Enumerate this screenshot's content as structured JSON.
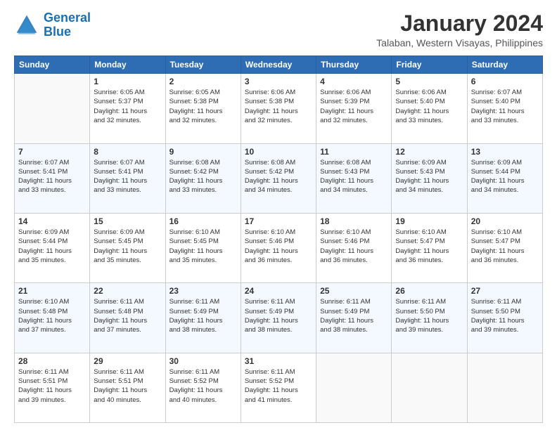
{
  "logo": {
    "line1": "General",
    "line2": "Blue"
  },
  "title": "January 2024",
  "subtitle": "Talaban, Western Visayas, Philippines",
  "days_of_week": [
    "Sunday",
    "Monday",
    "Tuesday",
    "Wednesday",
    "Thursday",
    "Friday",
    "Saturday"
  ],
  "weeks": [
    [
      {
        "day": "",
        "sunrise": "",
        "sunset": "",
        "daylight": ""
      },
      {
        "day": "1",
        "sunrise": "Sunrise: 6:05 AM",
        "sunset": "Sunset: 5:37 PM",
        "daylight": "Daylight: 11 hours and 32 minutes."
      },
      {
        "day": "2",
        "sunrise": "Sunrise: 6:05 AM",
        "sunset": "Sunset: 5:38 PM",
        "daylight": "Daylight: 11 hours and 32 minutes."
      },
      {
        "day": "3",
        "sunrise": "Sunrise: 6:06 AM",
        "sunset": "Sunset: 5:38 PM",
        "daylight": "Daylight: 11 hours and 32 minutes."
      },
      {
        "day": "4",
        "sunrise": "Sunrise: 6:06 AM",
        "sunset": "Sunset: 5:39 PM",
        "daylight": "Daylight: 11 hours and 32 minutes."
      },
      {
        "day": "5",
        "sunrise": "Sunrise: 6:06 AM",
        "sunset": "Sunset: 5:40 PM",
        "daylight": "Daylight: 11 hours and 33 minutes."
      },
      {
        "day": "6",
        "sunrise": "Sunrise: 6:07 AM",
        "sunset": "Sunset: 5:40 PM",
        "daylight": "Daylight: 11 hours and 33 minutes."
      }
    ],
    [
      {
        "day": "7",
        "sunrise": "Sunrise: 6:07 AM",
        "sunset": "Sunset: 5:41 PM",
        "daylight": "Daylight: 11 hours and 33 minutes."
      },
      {
        "day": "8",
        "sunrise": "Sunrise: 6:07 AM",
        "sunset": "Sunset: 5:41 PM",
        "daylight": "Daylight: 11 hours and 33 minutes."
      },
      {
        "day": "9",
        "sunrise": "Sunrise: 6:08 AM",
        "sunset": "Sunset: 5:42 PM",
        "daylight": "Daylight: 11 hours and 33 minutes."
      },
      {
        "day": "10",
        "sunrise": "Sunrise: 6:08 AM",
        "sunset": "Sunset: 5:42 PM",
        "daylight": "Daylight: 11 hours and 34 minutes."
      },
      {
        "day": "11",
        "sunrise": "Sunrise: 6:08 AM",
        "sunset": "Sunset: 5:43 PM",
        "daylight": "Daylight: 11 hours and 34 minutes."
      },
      {
        "day": "12",
        "sunrise": "Sunrise: 6:09 AM",
        "sunset": "Sunset: 5:43 PM",
        "daylight": "Daylight: 11 hours and 34 minutes."
      },
      {
        "day": "13",
        "sunrise": "Sunrise: 6:09 AM",
        "sunset": "Sunset: 5:44 PM",
        "daylight": "Daylight: 11 hours and 34 minutes."
      }
    ],
    [
      {
        "day": "14",
        "sunrise": "Sunrise: 6:09 AM",
        "sunset": "Sunset: 5:44 PM",
        "daylight": "Daylight: 11 hours and 35 minutes."
      },
      {
        "day": "15",
        "sunrise": "Sunrise: 6:09 AM",
        "sunset": "Sunset: 5:45 PM",
        "daylight": "Daylight: 11 hours and 35 minutes."
      },
      {
        "day": "16",
        "sunrise": "Sunrise: 6:10 AM",
        "sunset": "Sunset: 5:45 PM",
        "daylight": "Daylight: 11 hours and 35 minutes."
      },
      {
        "day": "17",
        "sunrise": "Sunrise: 6:10 AM",
        "sunset": "Sunset: 5:46 PM",
        "daylight": "Daylight: 11 hours and 36 minutes."
      },
      {
        "day": "18",
        "sunrise": "Sunrise: 6:10 AM",
        "sunset": "Sunset: 5:46 PM",
        "daylight": "Daylight: 11 hours and 36 minutes."
      },
      {
        "day": "19",
        "sunrise": "Sunrise: 6:10 AM",
        "sunset": "Sunset: 5:47 PM",
        "daylight": "Daylight: 11 hours and 36 minutes."
      },
      {
        "day": "20",
        "sunrise": "Sunrise: 6:10 AM",
        "sunset": "Sunset: 5:47 PM",
        "daylight": "Daylight: 11 hours and 36 minutes."
      }
    ],
    [
      {
        "day": "21",
        "sunrise": "Sunrise: 6:10 AM",
        "sunset": "Sunset: 5:48 PM",
        "daylight": "Daylight: 11 hours and 37 minutes."
      },
      {
        "day": "22",
        "sunrise": "Sunrise: 6:11 AM",
        "sunset": "Sunset: 5:48 PM",
        "daylight": "Daylight: 11 hours and 37 minutes."
      },
      {
        "day": "23",
        "sunrise": "Sunrise: 6:11 AM",
        "sunset": "Sunset: 5:49 PM",
        "daylight": "Daylight: 11 hours and 38 minutes."
      },
      {
        "day": "24",
        "sunrise": "Sunrise: 6:11 AM",
        "sunset": "Sunset: 5:49 PM",
        "daylight": "Daylight: 11 hours and 38 minutes."
      },
      {
        "day": "25",
        "sunrise": "Sunrise: 6:11 AM",
        "sunset": "Sunset: 5:49 PM",
        "daylight": "Daylight: 11 hours and 38 minutes."
      },
      {
        "day": "26",
        "sunrise": "Sunrise: 6:11 AM",
        "sunset": "Sunset: 5:50 PM",
        "daylight": "Daylight: 11 hours and 39 minutes."
      },
      {
        "day": "27",
        "sunrise": "Sunrise: 6:11 AM",
        "sunset": "Sunset: 5:50 PM",
        "daylight": "Daylight: 11 hours and 39 minutes."
      }
    ],
    [
      {
        "day": "28",
        "sunrise": "Sunrise: 6:11 AM",
        "sunset": "Sunset: 5:51 PM",
        "daylight": "Daylight: 11 hours and 39 minutes."
      },
      {
        "day": "29",
        "sunrise": "Sunrise: 6:11 AM",
        "sunset": "Sunset: 5:51 PM",
        "daylight": "Daylight: 11 hours and 40 minutes."
      },
      {
        "day": "30",
        "sunrise": "Sunrise: 6:11 AM",
        "sunset": "Sunset: 5:52 PM",
        "daylight": "Daylight: 11 hours and 40 minutes."
      },
      {
        "day": "31",
        "sunrise": "Sunrise: 6:11 AM",
        "sunset": "Sunset: 5:52 PM",
        "daylight": "Daylight: 11 hours and 41 minutes."
      },
      {
        "day": "",
        "sunrise": "",
        "sunset": "",
        "daylight": ""
      },
      {
        "day": "",
        "sunrise": "",
        "sunset": "",
        "daylight": ""
      },
      {
        "day": "",
        "sunrise": "",
        "sunset": "",
        "daylight": ""
      }
    ]
  ]
}
